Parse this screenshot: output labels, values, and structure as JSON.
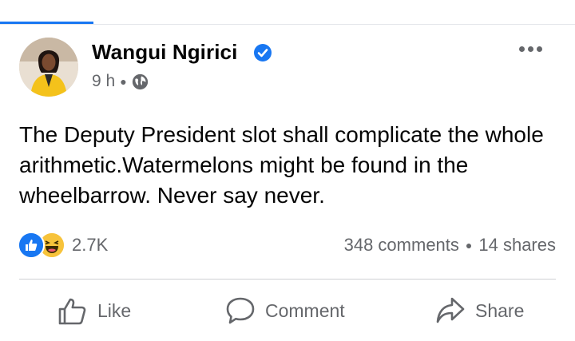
{
  "post": {
    "author": "Wangui Ngirici",
    "time": "9 h",
    "text": "The Deputy President slot shall complicate the whole arithmetic.Watermelons might be found in the wheelbarrow. Never say never.",
    "reaction_count": "2.7K",
    "comments": "348 comments",
    "shares": "14 shares"
  },
  "actions": {
    "like": "Like",
    "comment": "Comment",
    "share": "Share"
  },
  "colors": {
    "brand": "#1877f2",
    "secondary_text": "#65676b",
    "haha": "#f7c33b"
  }
}
